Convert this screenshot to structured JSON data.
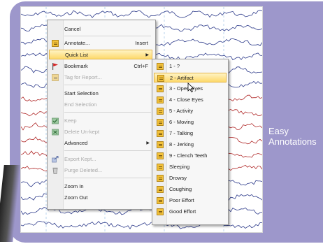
{
  "caption": {
    "line1": "Easy",
    "line2": "Annotations"
  },
  "menu": {
    "items": [
      {
        "label": "Cancel",
        "shortcut": "",
        "disabled": false
      },
      {
        "label": "Annotate...",
        "shortcut": "Insert",
        "disabled": false,
        "icon": "note-icon"
      },
      {
        "label": "Quick List",
        "shortcut": "",
        "disabled": false,
        "submenu": true
      },
      {
        "label": "Bookmark",
        "shortcut": "Ctrl+F",
        "disabled": false,
        "icon": "flag-icon"
      },
      {
        "label": "Tag for Report...",
        "shortcut": "",
        "disabled": true,
        "icon": "note-icon"
      },
      {
        "label": "Start Selection",
        "shortcut": "",
        "disabled": false
      },
      {
        "label": "End Selection",
        "shortcut": "",
        "disabled": true
      },
      {
        "label": "Keep",
        "shortcut": "",
        "disabled": true,
        "icon": "keep-icon"
      },
      {
        "label": "Delete Un-kept",
        "shortcut": "",
        "disabled": true,
        "icon": "delete-icon"
      },
      {
        "label": "Advanced",
        "shortcut": "",
        "disabled": false,
        "submenu": true
      },
      {
        "label": "Export Kept...",
        "shortcut": "",
        "disabled": true,
        "icon": "export-icon"
      },
      {
        "label": "Purge Deleted...",
        "shortcut": "",
        "disabled": true,
        "icon": "purge-icon"
      },
      {
        "label": "Zoom In",
        "shortcut": "",
        "disabled": false
      },
      {
        "label": "Zoom Out",
        "shortcut": "",
        "disabled": false
      }
    ]
  },
  "quick_list": {
    "items": [
      "1 - ?",
      "2 - Artifact",
      "3 - Open Eyes",
      "4 - Close Eyes",
      "5 - Activity",
      "6 - Moving",
      "7 - Talking",
      "8 - Jerking",
      "9 - Clench Teeth",
      "Sleeping",
      "Drowsy",
      "Coughing",
      "Poor Effort",
      "Good Effort"
    ],
    "highlighted": "2 - Artifact"
  },
  "colors": {
    "panel": "#9d97cb",
    "trace_blue": "#2c3a8a",
    "trace_red": "#b02828",
    "highlight": "#fdd96b"
  }
}
